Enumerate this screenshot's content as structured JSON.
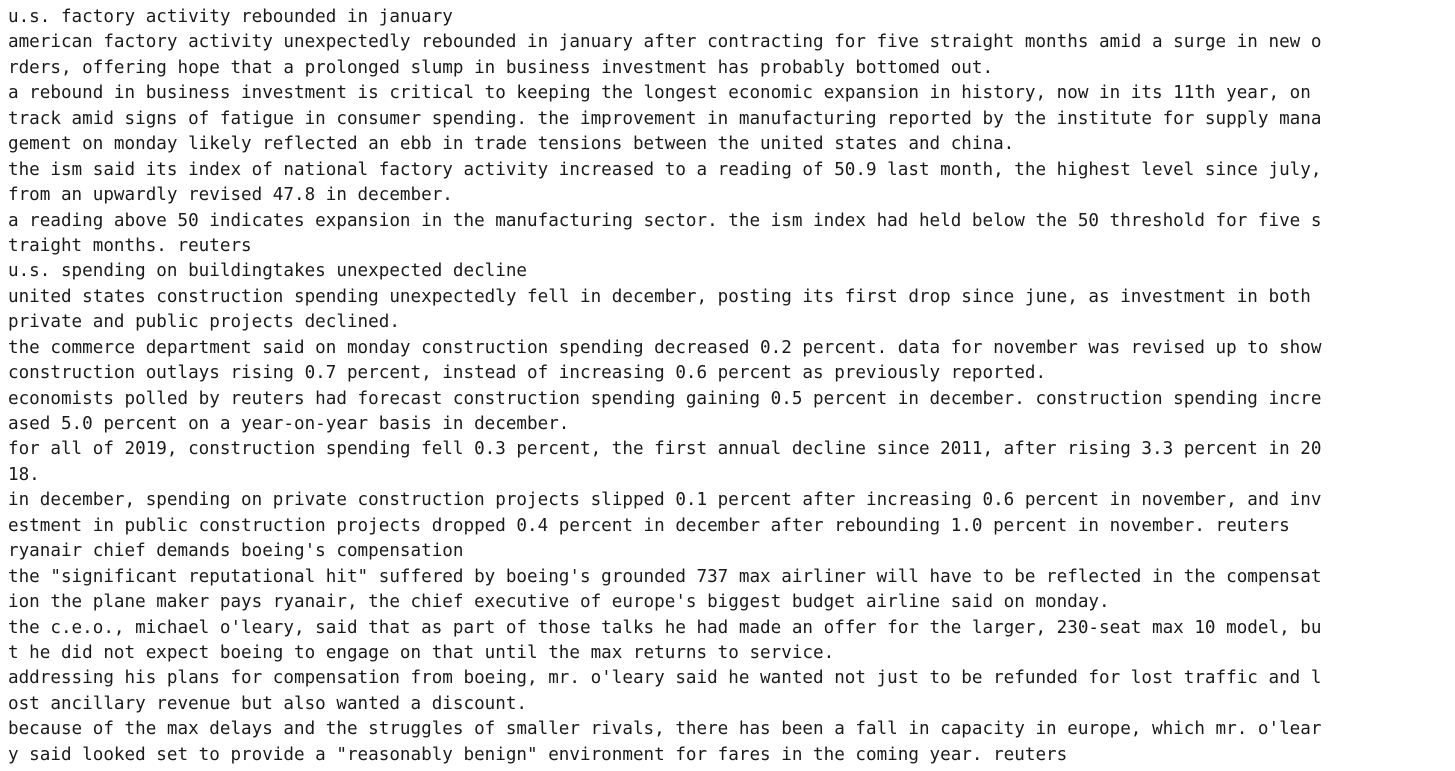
{
  "document": {
    "lines": [
      "u.s. factory activity rebounded in january",
      "american factory activity unexpectedly rebounded in january after contracting for five straight months amid a surge in new o",
      "rders, offering hope that a prolonged slump in business investment has probably bottomed out.",
      "a rebound in business investment is critical to keeping the longest economic expansion in history, now in its 11th year, on",
      "track amid signs of fatigue in consumer spending. the improvement in manufacturing reported by the institute for supply mana",
      "gement on monday likely reflected an ebb in trade tensions between the united states and china.",
      "the ism said its index of national factory activity increased to a reading of 50.9 last month, the highest level since july,",
      "from an upwardly revised 47.8 in december.",
      "a reading above 50 indicates expansion in the manufacturing sector. the ism index had held below the 50 threshold for five s",
      "traight months. reuters",
      "u.s. spending on buildingtakes unexpected decline",
      "united states construction spending unexpectedly fell in december, posting its first drop since june, as investment in both",
      "private and public projects declined.",
      "the commerce department said on monday construction spending decreased 0.2 percent. data for november was revised up to show",
      "construction outlays rising 0.7 percent, instead of increasing 0.6 percent as previously reported.",
      "economists polled by reuters had forecast construction spending gaining 0.5 percent in december. construction spending incre",
      "ased 5.0 percent on a year-on-year basis in december.",
      "for all of 2019, construction spending fell 0.3 percent, the first annual decline since 2011, after rising 3.3 percent in 20",
      "18.",
      "in december, spending on private construction projects slipped 0.1 percent after increasing 0.6 percent in november, and inv",
      "estment in public construction projects dropped 0.4 percent in december after rebounding 1.0 percent in november. reuters",
      "ryanair chief demands boeing's compensation",
      "the \"significant reputational hit\" suffered by boeing's grounded 737 max airliner will have to be reflected in the compensat",
      "ion the plane maker pays ryanair, the chief executive of europe's biggest budget airline said on monday.",
      "the c.e.o., michael o'leary, said that as part of those talks he had made an offer for the larger, 230-seat max 10 model, bu",
      "t he did not expect boeing to engage on that until the max returns to service.",
      "addressing his plans for compensation from boeing, mr. o'leary said he wanted not just to be refunded for lost traffic and l",
      "ost ancillary revenue but also wanted a discount.",
      "because of the max delays and the struggles of smaller rivals, there has been a fall in capacity in europe, which mr. o'lear",
      "y said looked set to provide a \"reasonably benign\" environment for fares in the coming year. reuters"
    ]
  }
}
